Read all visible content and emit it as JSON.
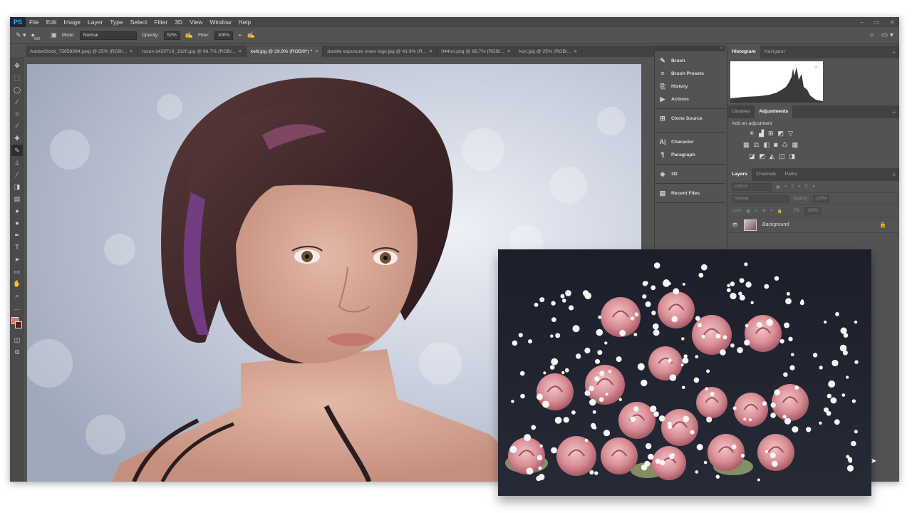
{
  "app": {
    "logo": "PS"
  },
  "menu": [
    "File",
    "Edit",
    "Image",
    "Layer",
    "Type",
    "Select",
    "Filter",
    "3D",
    "View",
    "Window",
    "Help"
  ],
  "window_controls": [
    "–",
    "▭",
    "✕"
  ],
  "options": {
    "brush_size": "600",
    "mode_label": "Mode:",
    "mode_value": "Normal",
    "opacity_label": "Opacity:",
    "opacity_value": "52%",
    "flow_label": "Flow:",
    "flow_value": "100%"
  },
  "tabs": [
    {
      "label": "AdobeStock_75858094.jpeg @ 25% (RGB/...",
      "close": "×"
    },
    {
      "label": "roses-1420719_1920.jpg @ 66.7% (RGB/...",
      "close": "×"
    },
    {
      "label": "kelli.jpg @ 29.9% (RGB/8*) *",
      "close": "×"
    },
    {
      "label": "double exposure roses logo.jpg @ 41.9% (R...",
      "close": "×"
    },
    {
      "label": "044ori.png @ 66.7% (RGB/...",
      "close": "×"
    },
    {
      "label": "kori.jpg @ 25% (RGB/...",
      "close": "×"
    }
  ],
  "active_tab_index": 2,
  "left_panel": {
    "collapse": "«",
    "groups": [
      [
        {
          "label": "Brush",
          "icon": "brush-panel-icon",
          "glyph": "✎"
        },
        {
          "label": "Brush Presets",
          "icon": "brush-presets-icon",
          "glyph": "≡"
        },
        {
          "label": "History",
          "icon": "history-icon",
          "glyph": "⎘"
        },
        {
          "label": "Actions",
          "icon": "actions-icon",
          "glyph": "▶"
        }
      ],
      [
        {
          "label": "Clone Source",
          "icon": "clone-source-icon",
          "glyph": "⊞"
        }
      ],
      [
        {
          "label": "Character",
          "icon": "character-icon",
          "glyph": "A|"
        },
        {
          "label": "Paragraph",
          "icon": "paragraph-icon",
          "glyph": "¶"
        }
      ],
      [
        {
          "label": "3D",
          "icon": "3d-icon",
          "glyph": "◈"
        }
      ],
      [
        {
          "label": "Recent Files",
          "icon": "recent-files-icon",
          "glyph": "▤"
        }
      ]
    ]
  },
  "histogram_panel": {
    "tabs": [
      "Histogram",
      "Navigator"
    ],
    "warning": "▲"
  },
  "adjustments_panel": {
    "tabs": [
      "Libraries",
      "Adjustments"
    ],
    "title": "Add an adjustment"
  },
  "layers_panel": {
    "tabs": [
      "Layers",
      "Channels",
      "Paths"
    ],
    "filter_placeholder": "ρ Kind",
    "blend_mode": "Normal",
    "opacity_label": "Opacity:",
    "opacity_value": "100%",
    "lock_label": "Lock:",
    "fill_label": "Fill:",
    "fill_value": "100%",
    "layer_name": "Background",
    "eye": "👁"
  },
  "colors": {
    "foreground": "#d9756e",
    "background": "#5b1f20",
    "ui_dark": "#535353",
    "ps_blue": "#31a8ff"
  }
}
